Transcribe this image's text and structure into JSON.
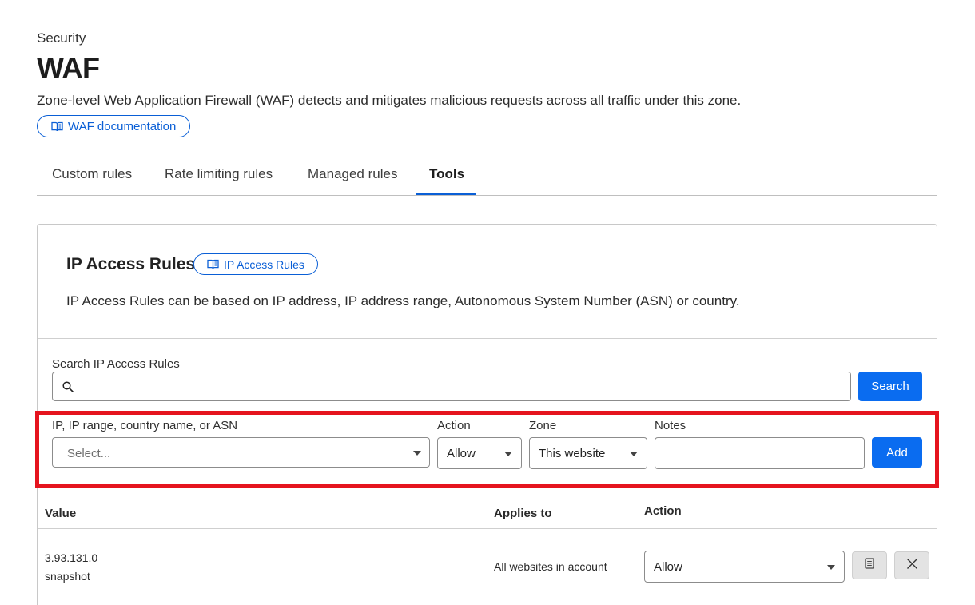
{
  "header": {
    "breadcrumb": "Security",
    "title": "WAF",
    "description": "Zone-level Web Application Firewall (WAF) detects and mitigates malicious requests across all traffic under this zone.",
    "doc_link": "WAF documentation"
  },
  "tabs": [
    {
      "label": "Custom rules",
      "active": false
    },
    {
      "label": "Rate limiting rules",
      "active": false
    },
    {
      "label": "Managed rules",
      "active": false
    },
    {
      "label": "Tools",
      "active": true
    }
  ],
  "ip_access": {
    "title": "IP Access Rules",
    "doc_link": "IP Access Rules",
    "description": "IP Access Rules can be based on IP address, IP address range, Autonomous System Number (ASN) or country.",
    "search": {
      "label": "Search IP Access Rules",
      "value": "",
      "button": "Search"
    },
    "form": {
      "ip_label": "IP, IP range, country name, or ASN",
      "ip_placeholder": "Select...",
      "action_label": "Action",
      "action_value": "Allow",
      "zone_label": "Zone",
      "zone_value": "This website",
      "notes_label": "Notes",
      "notes_value": "",
      "add_button": "Add"
    },
    "table": {
      "columns": [
        "Value",
        "Applies to",
        "Action"
      ],
      "rows": [
        {
          "value": "3.93.131.0",
          "note": "snapshot",
          "applies_to": "All websites in account",
          "action": "Allow"
        }
      ]
    }
  },
  "colors": {
    "accent": "#0a6cf0",
    "link": "#0a5fd6",
    "highlight": "#e5141e"
  },
  "icons": {
    "doc": "book-icon",
    "search": "search-icon",
    "caret": "chevron-down-icon",
    "edit": "note-icon",
    "delete": "close-icon"
  }
}
